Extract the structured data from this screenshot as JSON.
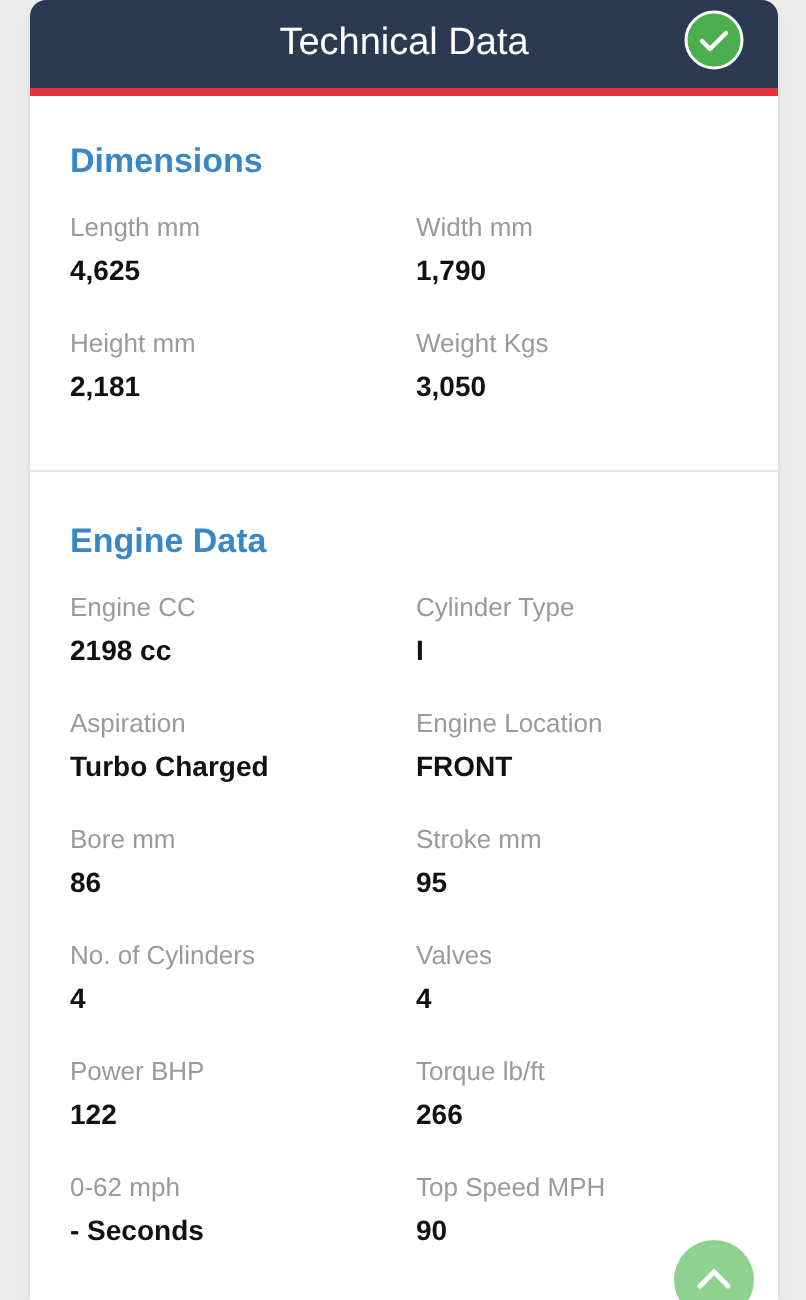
{
  "header": {
    "title": "Technical Data"
  },
  "sections": [
    {
      "title": "Dimensions",
      "fields": [
        {
          "label": "Length mm",
          "value": "4,625"
        },
        {
          "label": "Width mm",
          "value": "1,790"
        },
        {
          "label": "Height mm",
          "value": "2,181"
        },
        {
          "label": "Weight Kgs",
          "value": "3,050"
        }
      ]
    },
    {
      "title": "Engine Data",
      "fields": [
        {
          "label": "Engine CC",
          "value": "2198 cc"
        },
        {
          "label": "Cylinder Type",
          "value": "I"
        },
        {
          "label": "Aspiration",
          "value": "Turbo Charged"
        },
        {
          "label": "Engine Location",
          "value": "FRONT"
        },
        {
          "label": "Bore mm",
          "value": "86"
        },
        {
          "label": "Stroke mm",
          "value": "95"
        },
        {
          "label": "No. of Cylinders",
          "value": "4"
        },
        {
          "label": "Valves",
          "value": "4"
        },
        {
          "label": "Power BHP",
          "value": "122"
        },
        {
          "label": "Torque lb/ft",
          "value": "266"
        },
        {
          "label": "0-62 mph",
          "value": "- Seconds"
        },
        {
          "label": "Top Speed MPH",
          "value": "90"
        }
      ]
    }
  ]
}
